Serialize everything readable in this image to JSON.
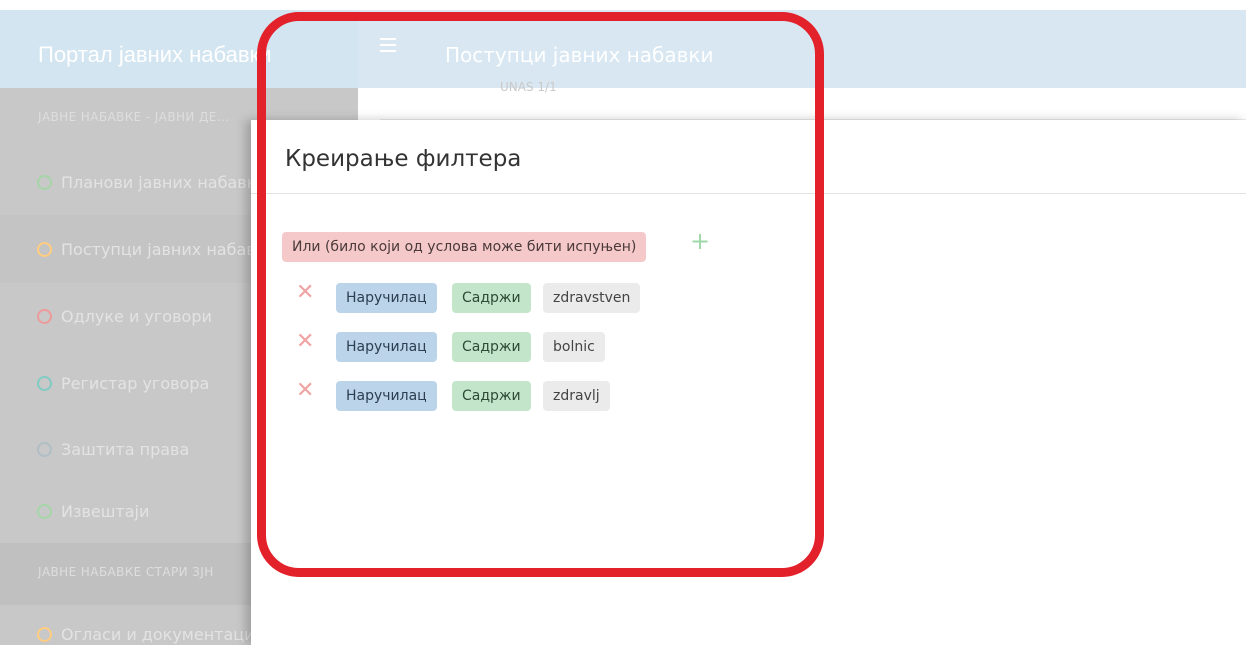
{
  "header": {
    "brand": "Портал јавних набавки",
    "title": "Поступци јавних набавки"
  },
  "main": {
    "peek_text": "UNAS 1/1"
  },
  "sidebar": {
    "section1": "ЈАВНЕ НАБАВКЕ - ЈАВНИ ДЕ...",
    "items": [
      {
        "label": "Планови јавних набавки",
        "ring_color": "#a5d6a7"
      },
      {
        "label": "Поступци јавних набавки",
        "ring_color": "#ffcc80"
      },
      {
        "label": "Одлуке и уговори",
        "ring_color": "#ef9a9a"
      },
      {
        "label": "Регистар уговора",
        "ring_color": "#80cbc4"
      },
      {
        "label": "Заштита права",
        "ring_color": "#b0bec5"
      },
      {
        "label": "Извештаји",
        "ring_color": "#a5d6a7"
      }
    ],
    "section2": "ЈАВНЕ НАБАВКЕ СТАРИ ЗЈН",
    "items2": [
      {
        "label": "Огласи и документација",
        "ring_color": "#ffcc80"
      }
    ]
  },
  "modal": {
    "title": "Креирање филтера",
    "group_label": "Или (било који од услова може бити испуњен)",
    "add_symbol": "+",
    "remove_symbol": "✕",
    "conditions": [
      {
        "field": "Наручилац",
        "operator": "Садржи",
        "value": "zdravstven"
      },
      {
        "field": "Наручилац",
        "operator": "Садржи",
        "value": "bolnic"
      },
      {
        "field": "Наручилац",
        "operator": "Садржи",
        "value": "zdravlj"
      }
    ]
  },
  "colors": {
    "highlight": "#e3212b",
    "or_tag": "#f5c9ca",
    "field_tag": "#bbd4ea",
    "operator_tag": "#c3e6cb",
    "value_tag": "#ebebeb"
  }
}
